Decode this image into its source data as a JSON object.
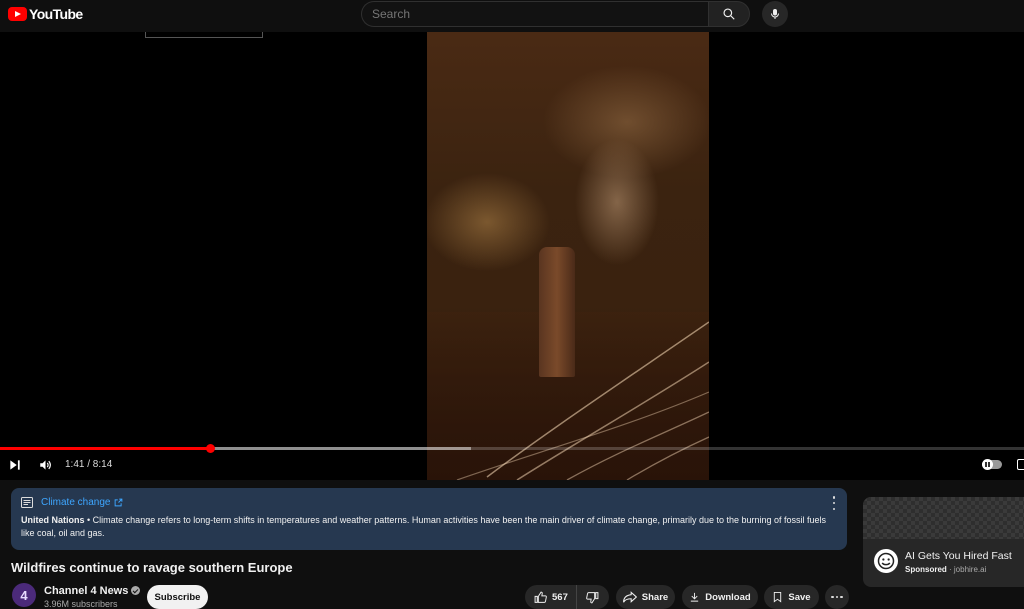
{
  "masthead": {
    "logo_text": "YouTube",
    "search_placeholder": "Search",
    "icons": [
      "youtube-logo-icon",
      "search-icon",
      "microphone-icon"
    ]
  },
  "player": {
    "current_time": "1:41",
    "duration": "8:14",
    "time_display": "1:41 / 8:14",
    "played_fraction": 0.205,
    "buffered_fraction": 0.46,
    "accent_color": "#ff0000",
    "icons": [
      "next-icon",
      "volume-icon",
      "autoplay-toggle-icon",
      "captions-icon"
    ]
  },
  "info_panel": {
    "topic": "Climate change",
    "source": "United Nations",
    "separator": " • ",
    "description": "Climate change refers to long-term shifts in temperatures and weather patterns. Human activities have been the main driver of climate change, primarily due to the burning of fossil fuels like coal, oil and gas.",
    "background_color": "#263850",
    "link_color": "#3ea6ff",
    "icons": [
      "info-panel-icon",
      "external-link-icon",
      "more-vert-icon"
    ]
  },
  "video": {
    "title": "Wildfires continue to ravage southern Europe"
  },
  "channel": {
    "name": "Channel 4 News",
    "subscribers": "3.96M subscribers",
    "avatar_text": "4",
    "subscribe_label": "Subscribe"
  },
  "actions": {
    "like_count": "567",
    "share_label": "Share",
    "download_label": "Download",
    "save_label": "Save",
    "icons": [
      "like-icon",
      "dislike-icon",
      "share-icon",
      "download-icon",
      "save-icon",
      "more-horiz-icon"
    ]
  },
  "ad": {
    "title": "AI Gets You Hired Fast",
    "sponsored_label": "Sponsored",
    "separator": " · ",
    "domain": "jobhire.ai"
  }
}
